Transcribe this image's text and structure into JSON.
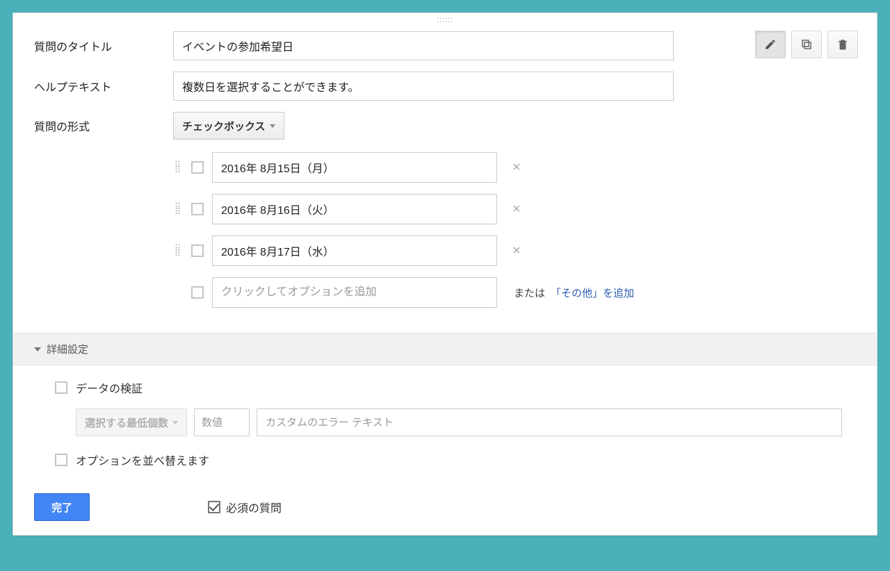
{
  "labels": {
    "title": "質問のタイトル",
    "help": "ヘルプテキスト",
    "type": "質問の形式"
  },
  "fields": {
    "title_value": "イベントの参加希望日",
    "help_value": "複数日を選択することができます。",
    "type_value": "チェックボックス"
  },
  "options": [
    "2016年 8月15日（月）",
    "2016年 8月16日（火）",
    "2016年 8月17日（水）"
  ],
  "add_option_placeholder": "クリックしてオプションを追加",
  "or_text": "または",
  "add_other_text": "「その他」を追加",
  "advanced": {
    "header": "詳細設定",
    "validate_label": "データの検証",
    "min_select_label": "選択する最低個数",
    "number_placeholder": "数値",
    "error_placeholder": "カスタムのエラー テキスト",
    "reorder_label": "オプションを並べ替えます"
  },
  "footer": {
    "done": "完了",
    "required": "必須の質問"
  }
}
